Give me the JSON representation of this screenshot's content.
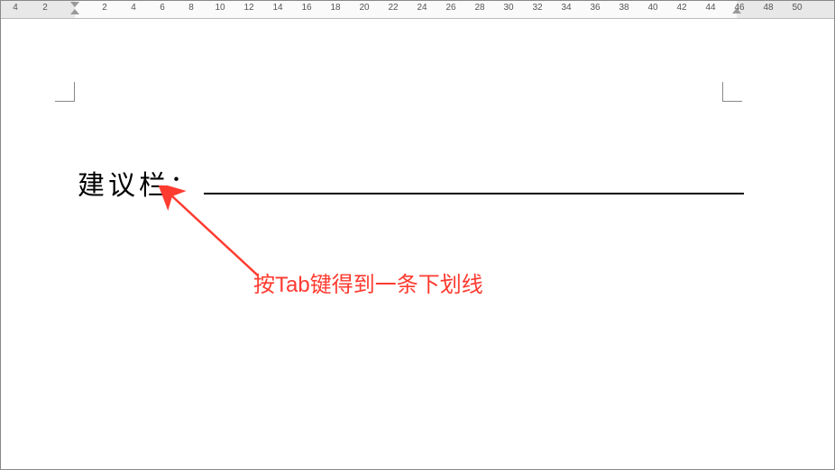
{
  "ruler": {
    "ticks_left": [
      "4",
      "2"
    ],
    "ticks_main": [
      "2",
      "4",
      "6",
      "8",
      "10",
      "12",
      "14",
      "16",
      "18",
      "20",
      "22",
      "24",
      "26",
      "28",
      "30",
      "32",
      "34",
      "36",
      "38",
      "40",
      "42",
      "44",
      "46"
    ],
    "ticks_right": [
      "48",
      "50"
    ]
  },
  "document": {
    "label": "建议栏：",
    "underline_content": ""
  },
  "annotation": {
    "text": "按Tab键得到一条下划线",
    "arrow_color": "#ff3b30"
  }
}
